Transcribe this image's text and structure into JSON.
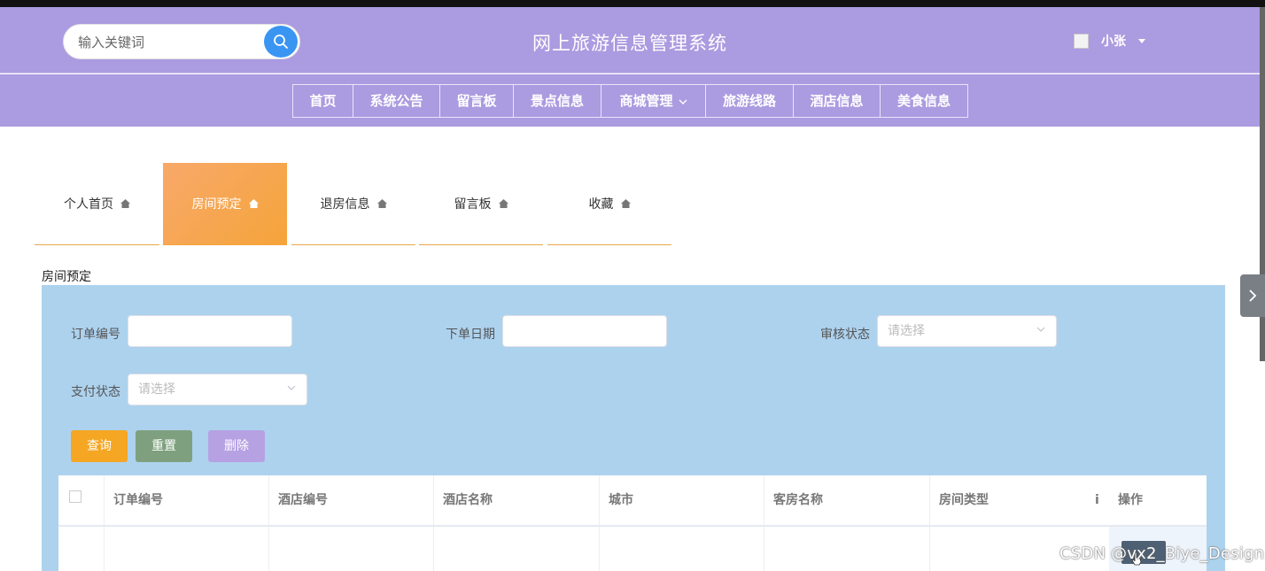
{
  "header": {
    "search_placeholder": "输入关键词",
    "site_title": "网上旅游信息管理系统",
    "username": "小张"
  },
  "nav": {
    "items": [
      {
        "label": "首页"
      },
      {
        "label": "系统公告"
      },
      {
        "label": "留言板"
      },
      {
        "label": "景点信息"
      },
      {
        "label": "商城管理"
      },
      {
        "label": "旅游线路"
      },
      {
        "label": "酒店信息"
      },
      {
        "label": "美食信息"
      }
    ]
  },
  "tabs": [
    {
      "label": "个人首页",
      "active": false
    },
    {
      "label": "房间预定",
      "active": true
    },
    {
      "label": "退房信息",
      "active": false
    },
    {
      "label": "留言板",
      "active": false
    },
    {
      "label": "收藏",
      "active": false
    }
  ],
  "section_title": "房间预定",
  "filters": {
    "order_no_label": "订单编号",
    "order_date_label": "下单日期",
    "audit_status_label": "审核状态",
    "audit_status_placeholder": "请选择",
    "pay_status_label": "支付状态",
    "pay_status_placeholder": "请选择"
  },
  "buttons": {
    "query": "查询",
    "reset": "重置",
    "delete": "删除"
  },
  "table": {
    "columns": [
      "订单编号",
      "酒店编号",
      "酒店名称",
      "城市",
      "客房名称",
      "房间类型",
      "i",
      "操作"
    ]
  },
  "watermark": "CSDN @vx2_Biye_Design",
  "colors": {
    "header_bg": "#ab9be0",
    "active_tab": "#f5a43a",
    "panel_bg": "#add2ee",
    "search_btn": "#3a95f2"
  }
}
